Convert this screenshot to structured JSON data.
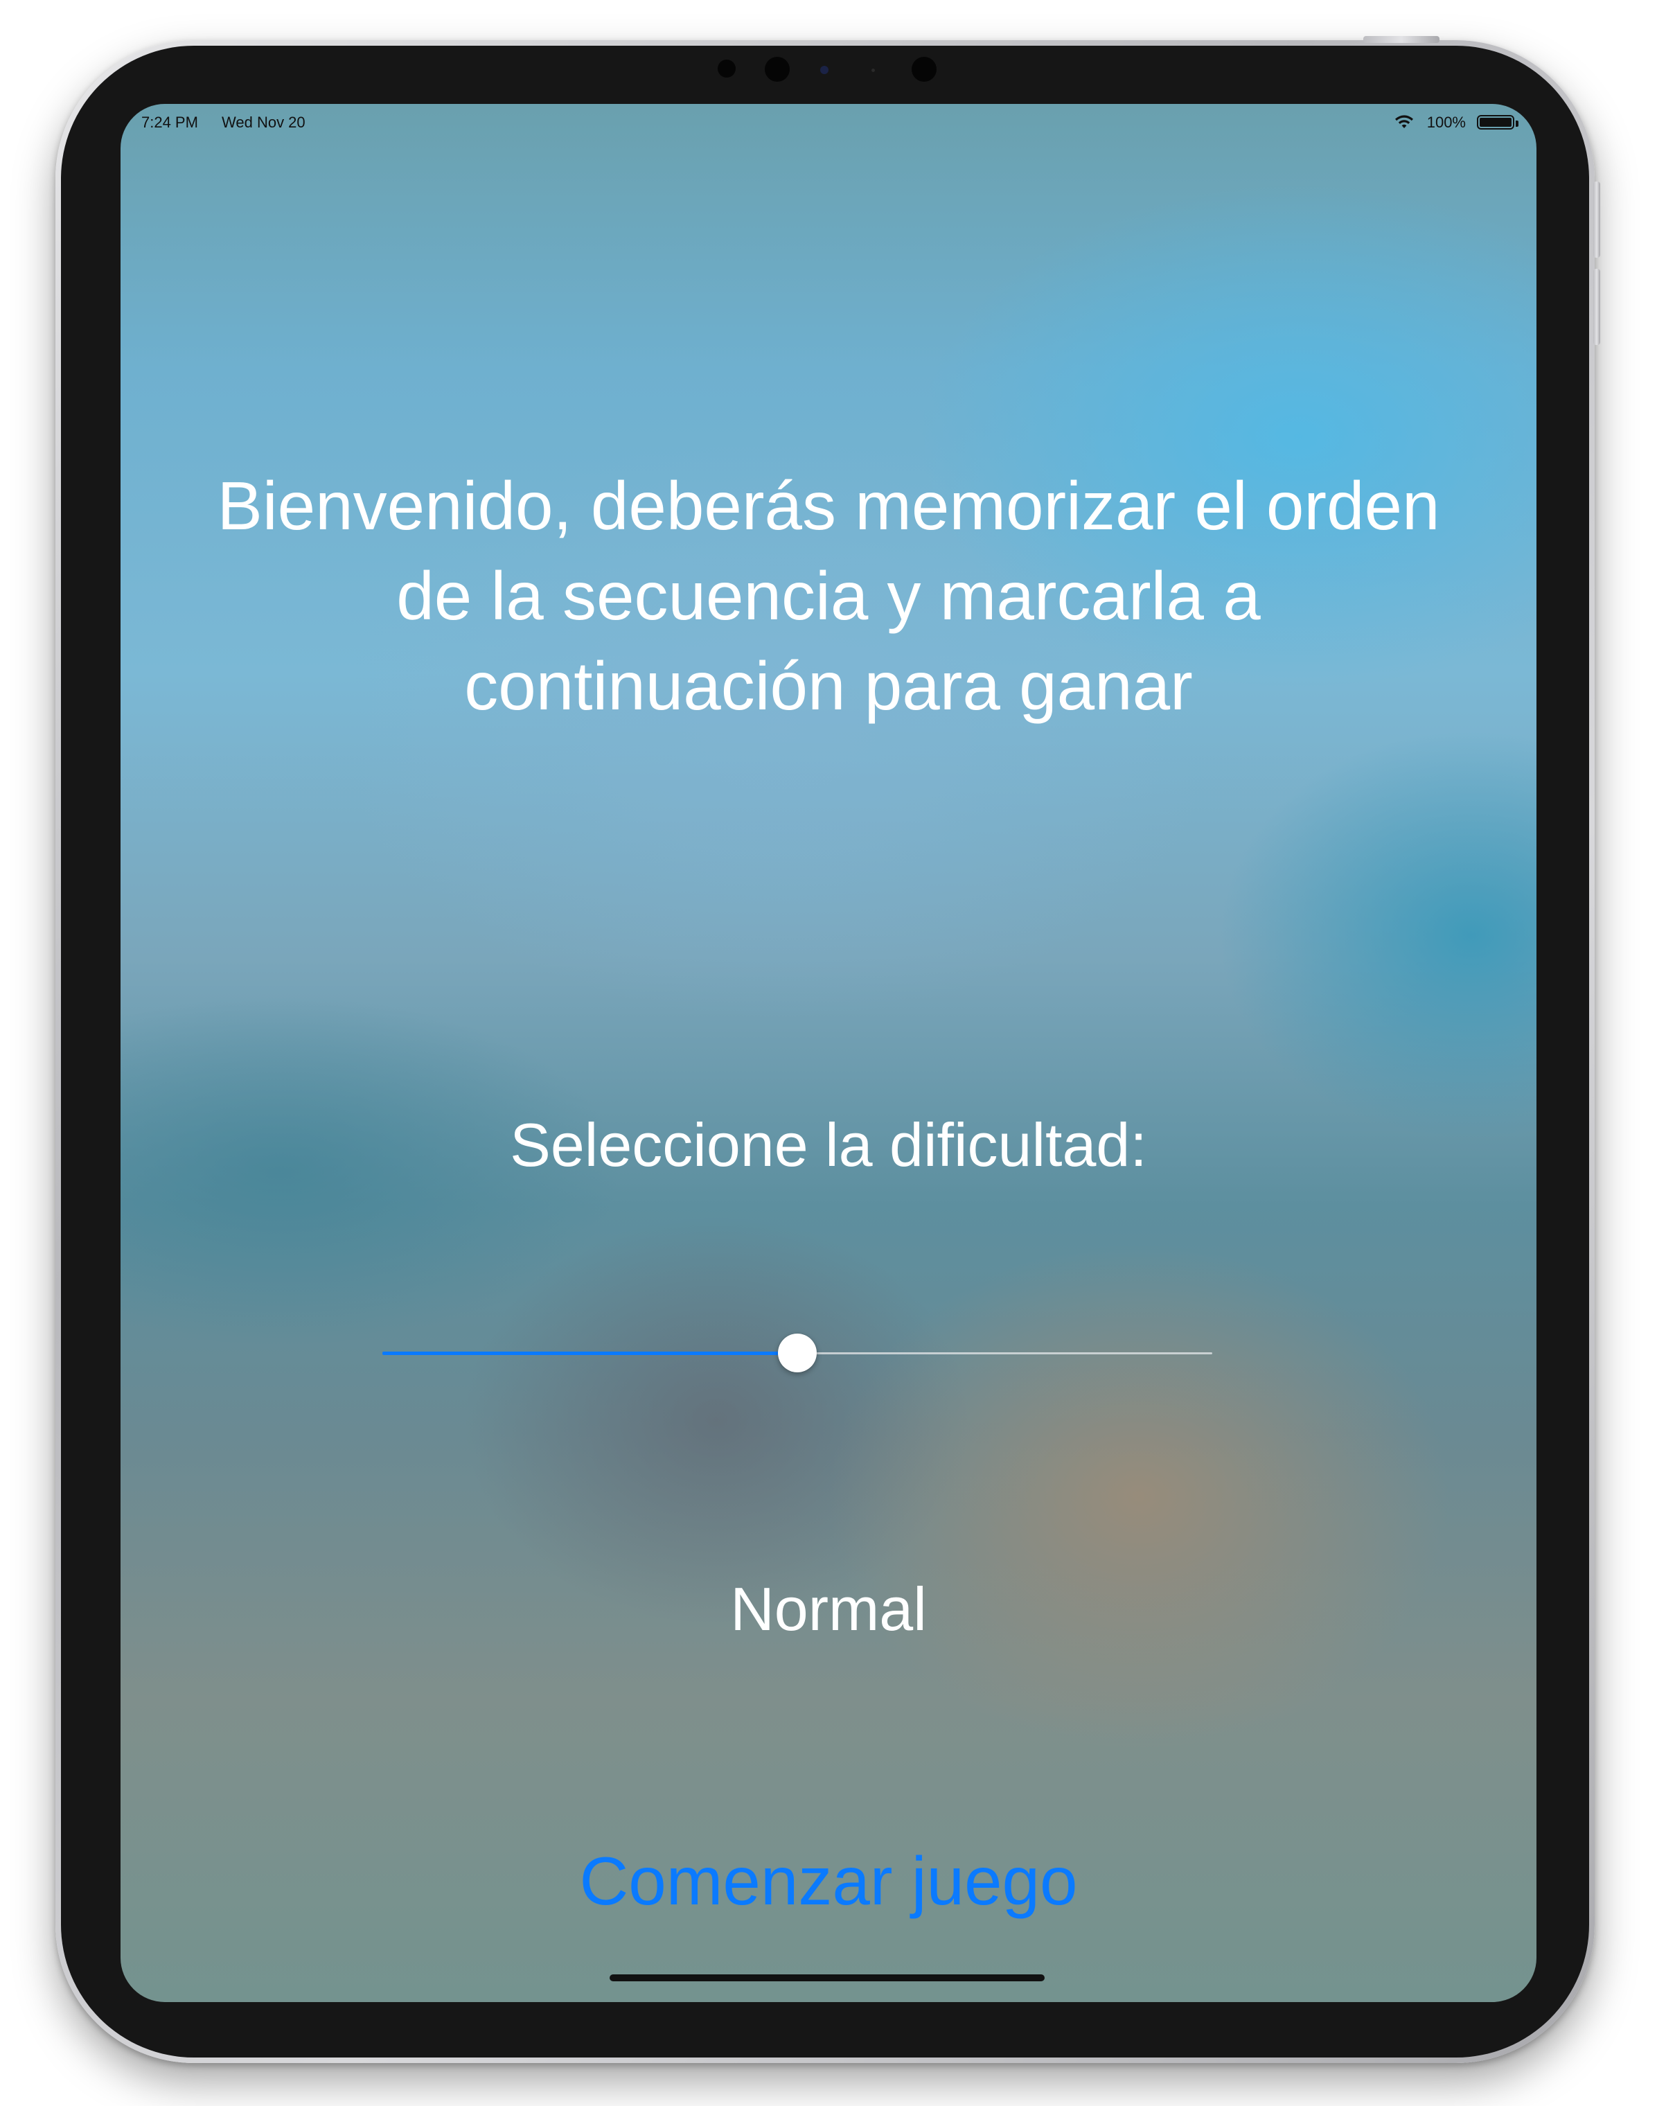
{
  "status_bar": {
    "time": "7:24 PM",
    "date": "Wed Nov 20",
    "battery_percent": "100%",
    "icons": [
      "wifi-icon",
      "battery-icon"
    ]
  },
  "welcome": {
    "lines": [
      "Bienvenido, deberás memorizar el orden",
      "de la secuencia y marcarla a",
      "continuación para ganar"
    ]
  },
  "difficulty": {
    "label": "Seleccione la dificultad:",
    "slider_value": 0.5,
    "value_label": "Normal"
  },
  "start_button": {
    "label": "Comenzar juego"
  },
  "colors": {
    "accent": "#0a7aff",
    "text": "#ffffff"
  }
}
